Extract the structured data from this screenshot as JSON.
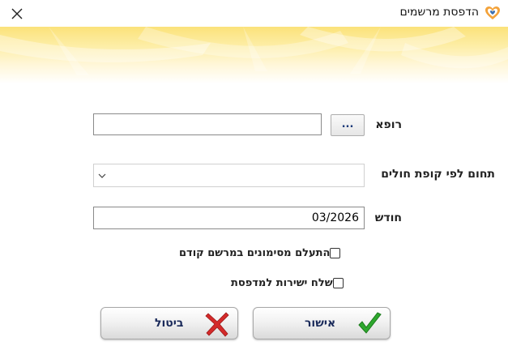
{
  "window": {
    "title": "הדפסת מרשמים",
    "close_label": "✕"
  },
  "form": {
    "doctor_label": "רופא",
    "doctor_value": "",
    "browse_label": "...",
    "hmo_label": "תחום לפי קופת חולים",
    "hmo_value": "",
    "month_label": "חודש",
    "month_value": "03/2026"
  },
  "options": {
    "ignore_previous_label": "התעלם מסימונים במרשם קודם",
    "ignore_previous_checked": false,
    "send_direct_label": "שלח ישירות למדפסת",
    "send_direct_checked": false
  },
  "buttons": {
    "ok_label": "אישור",
    "cancel_label": "ביטול"
  },
  "icons": {
    "app_logo": "heart-logo-icon",
    "close": "close-icon",
    "dropdown": "chevron-down-icon",
    "ok": "green-check-icon",
    "cancel": "red-x-icon"
  },
  "colors": {
    "banner": "#fbe27a",
    "ok_icon": "#2ea82e",
    "cancel_icon": "#d42a2a",
    "button_text": "#1a2a5a"
  }
}
